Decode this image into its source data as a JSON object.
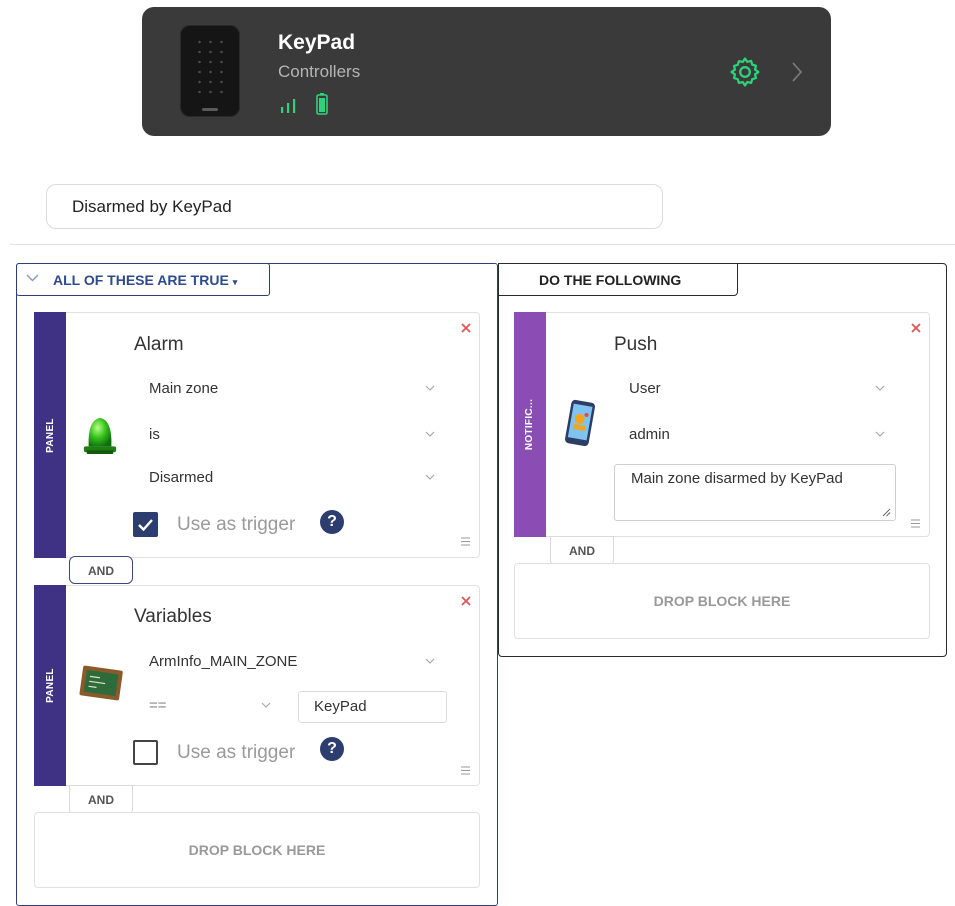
{
  "device": {
    "title": "KeyPad",
    "subtitle": "Controllers",
    "accent": "#2fd17a",
    "icons": [
      "signal-icon",
      "battery-icon",
      "gear-icon",
      "chevron-right-icon"
    ]
  },
  "rule_name": "Disarmed by KeyPad",
  "conditions": {
    "header": "ALL OF THESE ARE TRUE",
    "blocks": [
      {
        "category": "PANEL",
        "title": "Alarm",
        "icon": "siren-icon",
        "fields": [
          "Main zone",
          "is",
          "Disarmed"
        ],
        "trigger_label": "Use as trigger",
        "trigger_checked": true
      },
      {
        "category": "PANEL",
        "title": "Variables",
        "icon": "chalkboard-icon",
        "field": "ArmInfo_MAIN_ZONE",
        "operator": "==",
        "value": "KeyPad",
        "trigger_label": "Use as trigger",
        "trigger_checked": false
      }
    ],
    "and_label": "AND",
    "drop_label": "DROP BLOCK HERE"
  },
  "actions": {
    "header": "DO THE FOLLOWING",
    "blocks": [
      {
        "category": "NOTIFIC...",
        "title": "Push",
        "icon": "phone-notification-icon",
        "fields": [
          "User",
          "admin"
        ],
        "message": "Main zone disarmed by KeyPad"
      }
    ],
    "and_label": "AND",
    "drop_label": "DROP BLOCK HERE"
  },
  "colors": {
    "panel_strip": "#3f3285",
    "notification_strip": "#8a4db3",
    "close": "#e05555",
    "checkbox": "#2d3e6e"
  }
}
